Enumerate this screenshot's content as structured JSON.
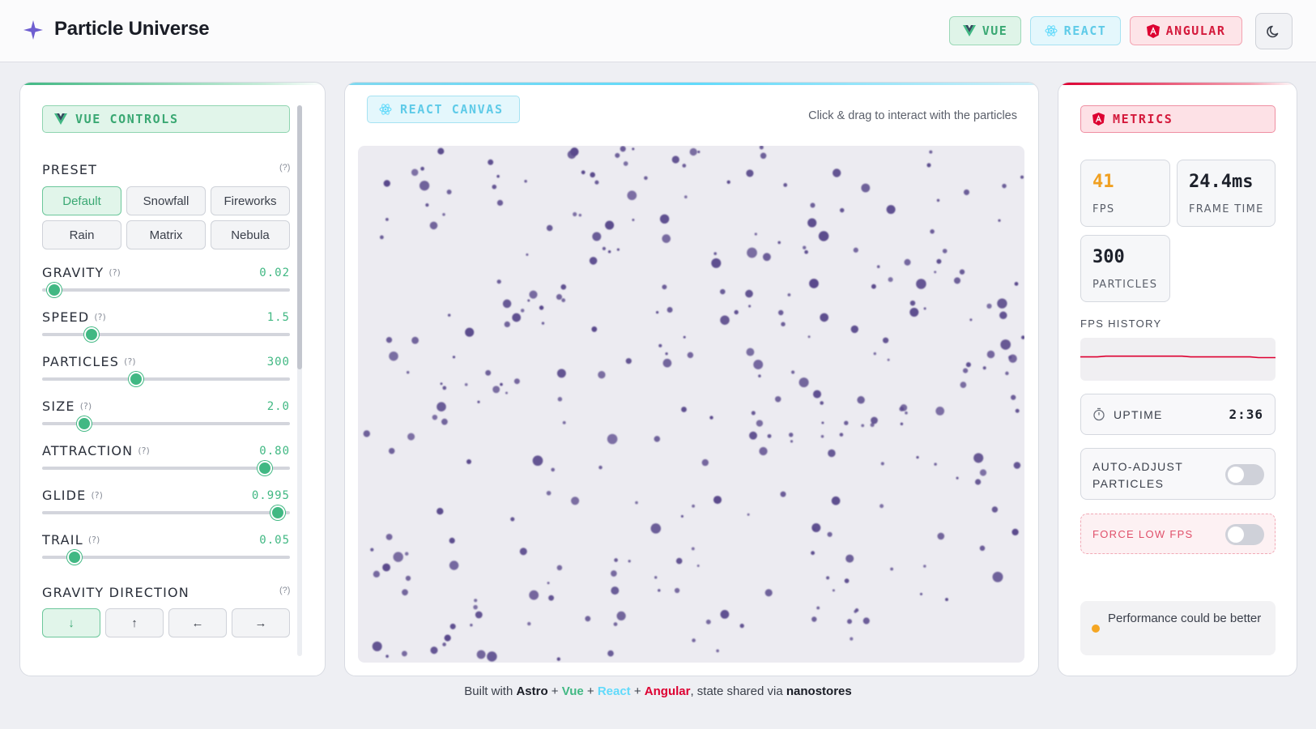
{
  "header": {
    "title": "Particle Universe",
    "badges": {
      "vue": "VUE",
      "react": "REACT",
      "angular": "ANGULAR"
    },
    "theme_icon": "moon-icon"
  },
  "colors": {
    "vue": "#41b883",
    "react": "#61dafb",
    "angular": "#dd0031",
    "particle": "#5a4a8c"
  },
  "controls": {
    "badge": "VUE CONTROLS",
    "preset_label": "PRESET",
    "help": "(?)",
    "presets": [
      "Default",
      "Snowfall",
      "Fireworks",
      "Rain",
      "Matrix",
      "Nebula"
    ],
    "active_preset": "Default",
    "sliders": [
      {
        "label": "GRAVITY",
        "value": "0.02",
        "fraction": 0.05
      },
      {
        "label": "SPEED",
        "value": "1.5",
        "fraction": 0.2
      },
      {
        "label": "PARTICLES",
        "value": "300",
        "fraction": 0.38
      },
      {
        "label": "SIZE",
        "value": "2.0",
        "fraction": 0.17
      },
      {
        "label": "ATTRACTION",
        "value": "0.80",
        "fraction": 0.9
      },
      {
        "label": "GLIDE",
        "value": "0.995",
        "fraction": 0.95
      },
      {
        "label": "TRAIL",
        "value": "0.05",
        "fraction": 0.13
      }
    ],
    "gravity_direction_label": "GRAVITY DIRECTION",
    "directions": [
      "↓",
      "↑",
      "←",
      "→"
    ]
  },
  "canvas": {
    "badge": "REACT CANVAS",
    "hint": "Click & drag to interact with the particles"
  },
  "metrics": {
    "badge": "METRICS",
    "fps": "41",
    "fps_label": "FPS",
    "frame_time": "24.4ms",
    "frame_time_label": "FRAME TIME",
    "particles": "300",
    "particles_label": "PARTICLES",
    "fps_history_label": "FPS HISTORY",
    "fps_history": [
      42,
      42,
      42,
      43,
      43,
      43,
      43,
      43,
      43,
      43,
      43,
      43,
      43,
      42,
      42,
      42,
      42,
      42,
      42,
      42,
      42,
      41,
      41,
      41
    ],
    "uptime_label": "UPTIME",
    "uptime": "2:36",
    "auto_adjust_label": "AUTO-ADJUST PARTICLES",
    "auto_adjust_on": false,
    "force_low_label": "FORCE LOW FPS",
    "force_low_on": false,
    "status_text": "Performance could be better",
    "status_color": "#f5a623"
  },
  "footer": {
    "prefix": "Built with ",
    "astro": "Astro",
    "plus": " + ",
    "vue": "Vue",
    "react": "React",
    "angular": "Angular",
    "mid": ", state shared via ",
    "nanostores": "nanostores"
  }
}
